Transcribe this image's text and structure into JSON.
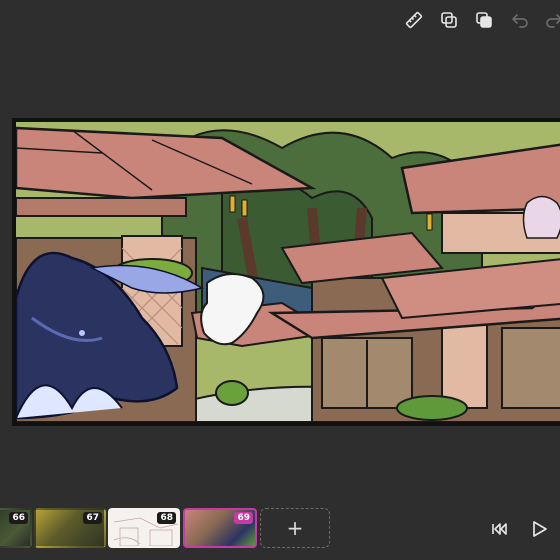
{
  "toolbar": {
    "icons": [
      "ruler-icon",
      "duplicate-icon",
      "layers-copy-icon",
      "undo-icon",
      "redo-icon"
    ]
  },
  "canvas": {
    "description_icon": "artwork-canvas"
  },
  "timeline": {
    "frames": [
      {
        "number": "66",
        "theme": "forest-dark"
      },
      {
        "number": "67",
        "theme": "forest-yellow"
      },
      {
        "number": "68",
        "theme": "sketch"
      },
      {
        "number": "69",
        "theme": "color-scene",
        "active": true
      }
    ],
    "add_label": "+",
    "controls": [
      "skip-to-start-icon",
      "play-icon"
    ]
  },
  "colors": {
    "background": "#2e2e2e",
    "active_frame": "#c63aa8",
    "roof": "#c9857a",
    "wall": "#e5c2ae",
    "dragon": "#2b3461"
  }
}
